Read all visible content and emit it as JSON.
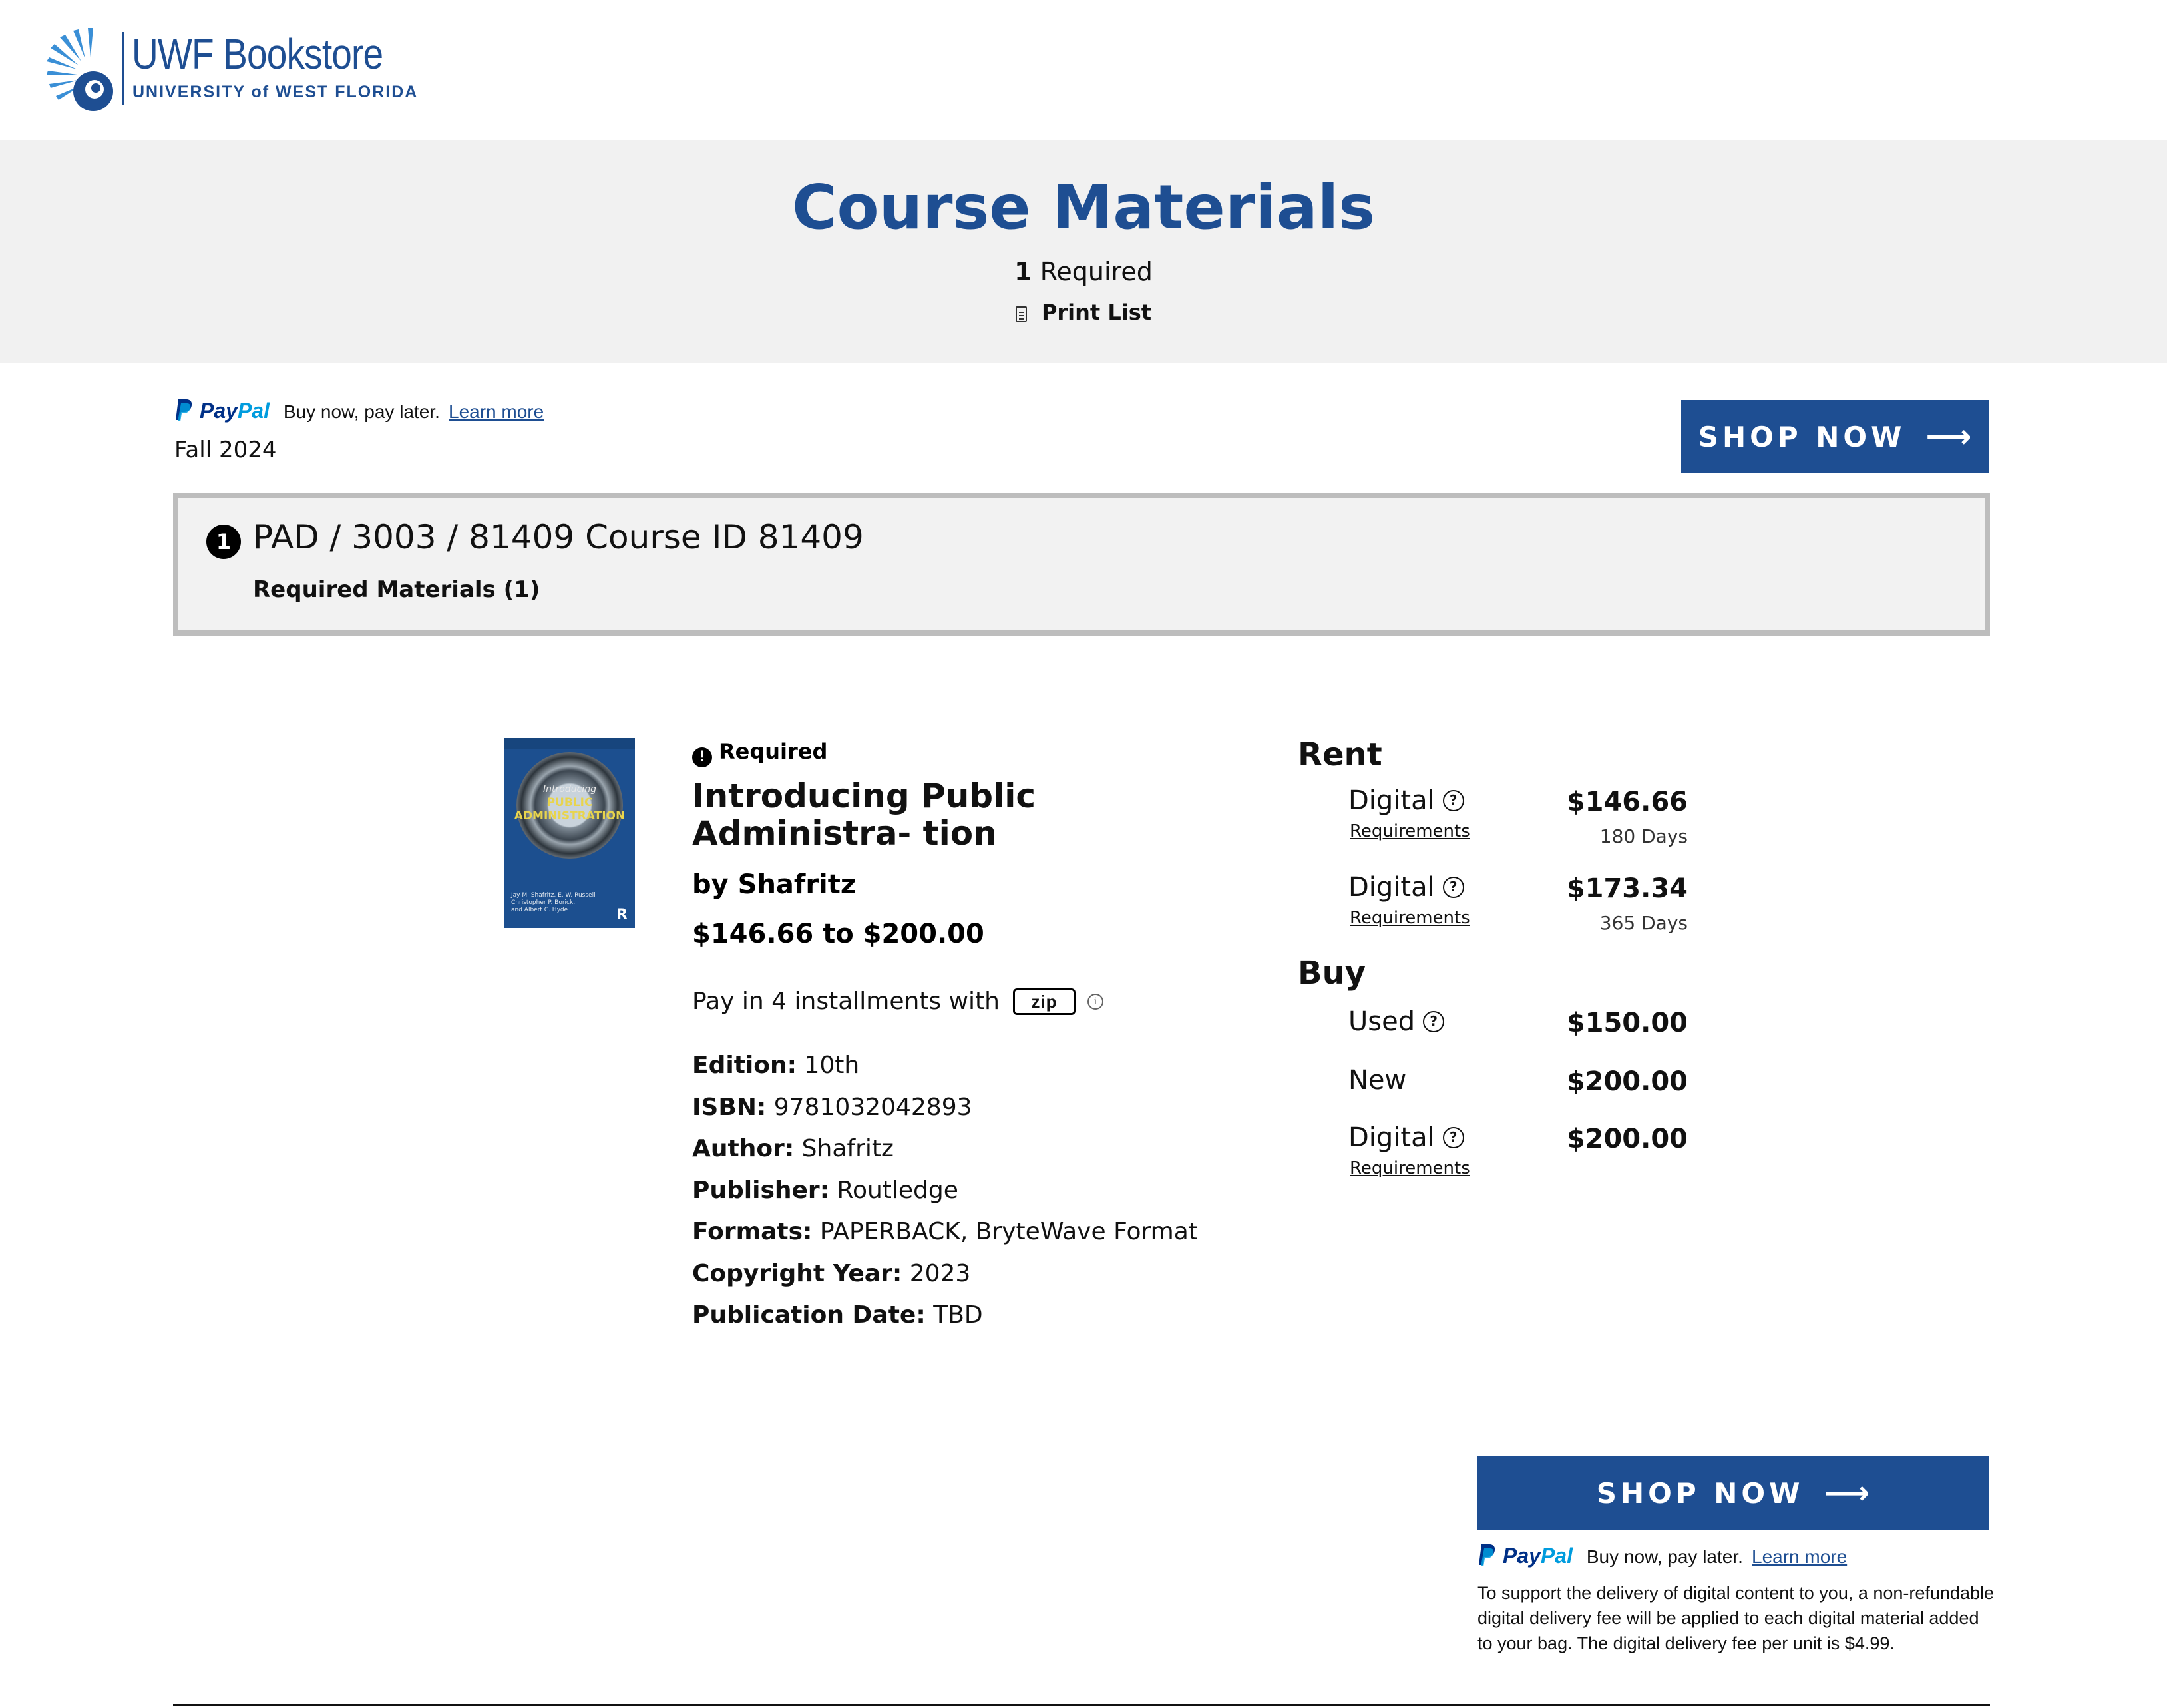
{
  "header": {
    "logo_title": "UWF Bookstore",
    "logo_subtitle": "UNIVERSITY of WEST FLORIDA",
    "brand_color": "#1e4e92"
  },
  "hero": {
    "title": "Course Materials",
    "required_count": "1",
    "required_label": "Required",
    "print_label": "Print List"
  },
  "paypal": {
    "logo_pay": "Pay",
    "logo_pal": "Pal",
    "tagline": "Buy now, pay later.",
    "learn_more": "Learn more"
  },
  "term": "Fall 2024",
  "shop_now": "SHOP NOW",
  "course": {
    "number": "1",
    "title": "PAD / 3003 / 81409 Course ID 81409",
    "required_materials": "Required Materials (1)"
  },
  "book": {
    "cover": {
      "t1": "Introducing",
      "t2": "PUBLIC",
      "t3": "ADMINISTRATION",
      "authors": "Jay M. Shafritz, E. W. Russell\nChristopher P. Borick,\nand Albert C. Hyde",
      "publisher_mark": "R"
    },
    "badge": "Required",
    "title": "Introducing Public Administra- tion",
    "by": "by Shafritz",
    "price_range": "$146.66 to $200.00",
    "zip_text": "Pay in 4 installments with",
    "zip_logo": "zip",
    "specs": [
      {
        "label": "Edition:",
        "value": "10th"
      },
      {
        "label": "ISBN:",
        "value": "9781032042893"
      },
      {
        "label": "Author:",
        "value": "Shafritz"
      },
      {
        "label": "Publisher:",
        "value": "Routledge"
      },
      {
        "label": "Formats:",
        "value": "PAPERBACK, BryteWave Format"
      },
      {
        "label": "Copyright Year:",
        "value": "2023"
      },
      {
        "label": "Publication Date:",
        "value": "TBD"
      }
    ]
  },
  "pricing": {
    "rent_heading": "Rent",
    "buy_heading": "Buy",
    "requirements_label": "Requirements",
    "rent": [
      {
        "label": "Digital",
        "price": "$146.66",
        "days": "180 Days"
      },
      {
        "label": "Digital",
        "price": "$173.34",
        "days": "365 Days"
      }
    ],
    "buy": [
      {
        "label": "Used",
        "price": "$150.00"
      },
      {
        "label": "New",
        "price": "$200.00"
      },
      {
        "label": "Digital",
        "price": "$200.00"
      }
    ]
  },
  "footer_note": "To support the delivery of digital content to you, a non-refundable digital delivery fee will be applied to each digital material added to your bag. The digital delivery fee per unit is $4.99."
}
